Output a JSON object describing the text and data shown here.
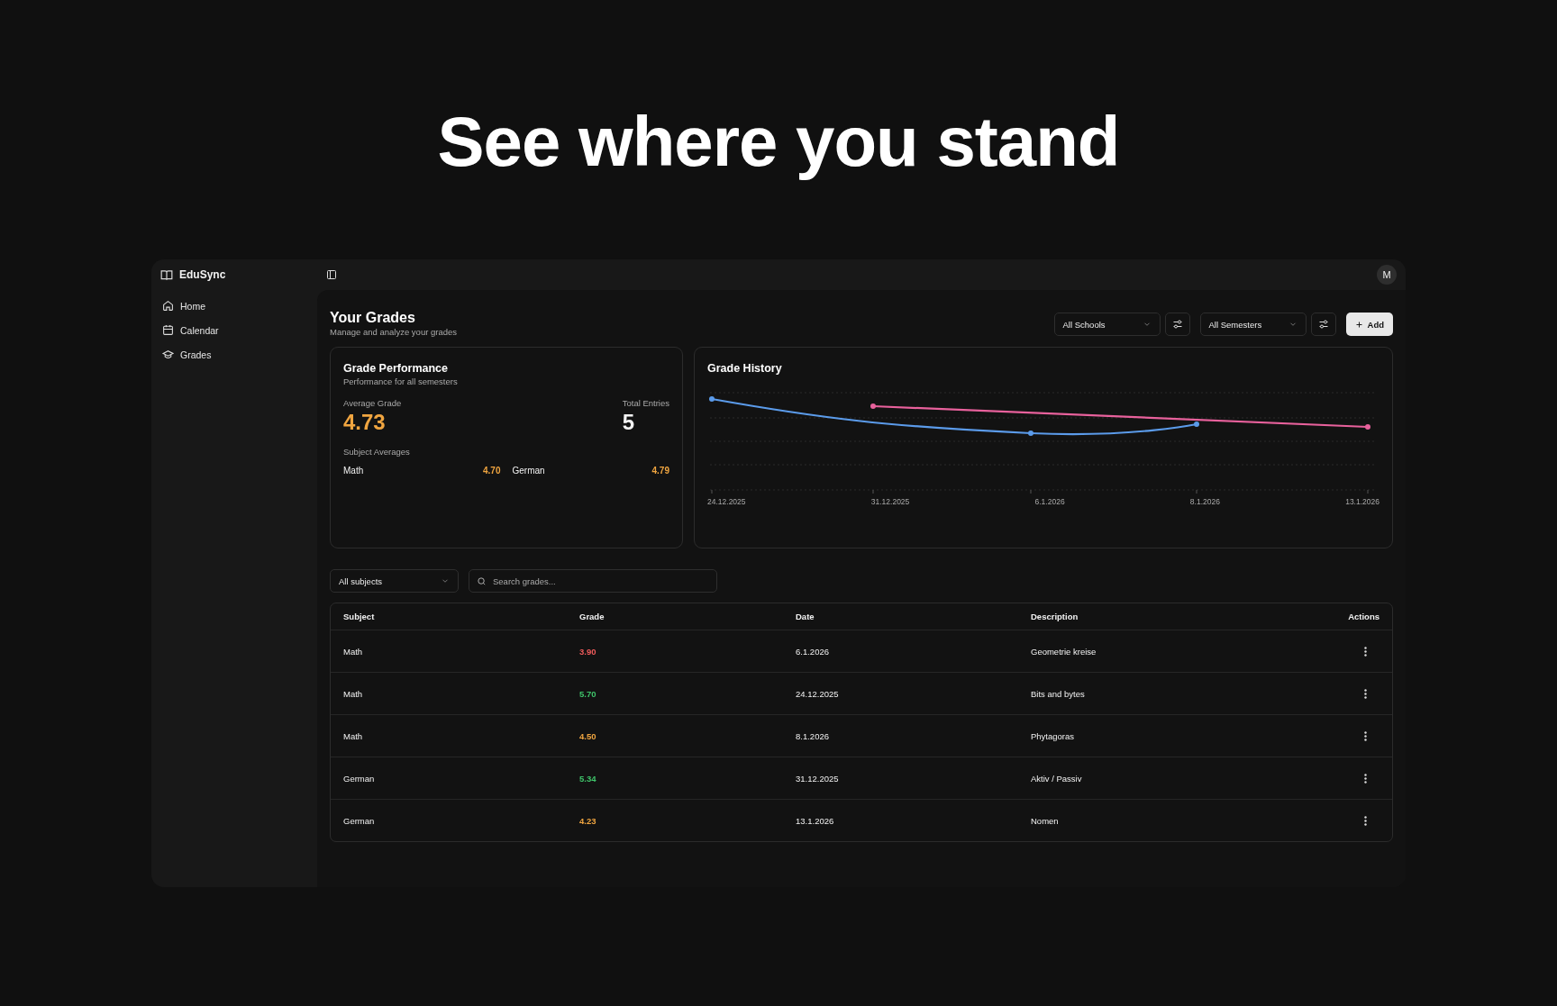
{
  "headline": "See where you stand",
  "sidebar": {
    "brand": "EduSync",
    "items": [
      {
        "label": "Home"
      },
      {
        "label": "Calendar"
      },
      {
        "label": "Grades"
      }
    ]
  },
  "avatar": "M",
  "header": {
    "title": "Your Grades",
    "subtitle": "Manage and analyze your grades"
  },
  "filters": {
    "school": "All Schools",
    "semester": "All Semesters",
    "add": "Add"
  },
  "performance": {
    "title": "Grade Performance",
    "subtitle": "Performance for all semesters",
    "average_label": "Average Grade",
    "average": "4.73",
    "total_label": "Total Entries",
    "total": "5",
    "subjects_label": "Subject Averages",
    "subjects": [
      {
        "name": "Math",
        "value": "4.70"
      },
      {
        "name": "German",
        "value": "4.79"
      }
    ]
  },
  "history": {
    "title": "Grade History",
    "x_labels": [
      "24.12.2025",
      "31.12.2025",
      "6.1.2026",
      "8.1.2026",
      "13.1.2026"
    ],
    "series": [
      {
        "color": "#5b9bea"
      },
      {
        "color": "#e8619c"
      }
    ]
  },
  "table_filters": {
    "subject": "All subjects",
    "search_placeholder": "Search grades..."
  },
  "table": {
    "columns": [
      "Subject",
      "Grade",
      "Date",
      "Description",
      "Actions"
    ],
    "rows": [
      {
        "subject": "Math",
        "grade": "3.90",
        "color": "#ef5b5b",
        "date": "6.1.2026",
        "description": "Geometrie kreise"
      },
      {
        "subject": "Math",
        "grade": "5.70",
        "color": "#3fc46a",
        "date": "24.12.2025",
        "description": "Bits and bytes"
      },
      {
        "subject": "Math",
        "grade": "4.50",
        "color": "#f0a540",
        "date": "8.1.2026",
        "description": "Phytagoras"
      },
      {
        "subject": "German",
        "grade": "5.34",
        "color": "#3fc46a",
        "date": "31.12.2025",
        "description": "Aktiv / Passiv"
      },
      {
        "subject": "German",
        "grade": "4.23",
        "color": "#f0a540",
        "date": "13.1.2026",
        "description": "Nomen"
      }
    ]
  }
}
